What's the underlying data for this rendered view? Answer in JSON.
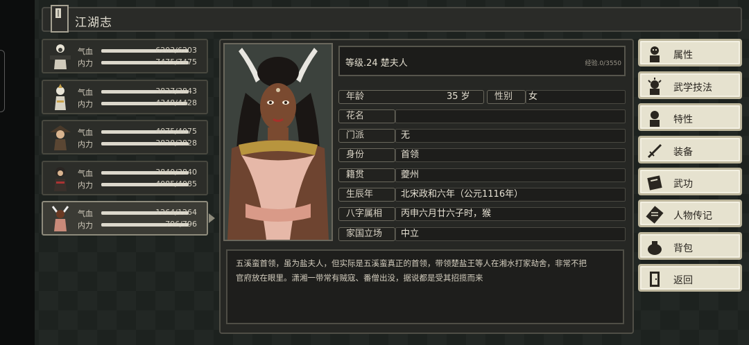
{
  "title": "江湖志",
  "party": [
    {
      "hp_label": "气血",
      "hp_text": "6203/6203",
      "hp": 1.0,
      "mp_label": "内力",
      "mp_text": "7475/7475",
      "mp": 1.0
    },
    {
      "hp_label": "气血",
      "hp_text": "3837/3843",
      "hp": 0.998,
      "mp_label": "内力",
      "mp_text": "4348/4428",
      "mp": 0.982
    },
    {
      "hp_label": "气血",
      "hp_text": "4075/4075",
      "hp": 1.0,
      "mp_label": "内力",
      "mp_text": "3828/3828",
      "mp": 1.0
    },
    {
      "hp_label": "气血",
      "hp_text": "3840/3840",
      "hp": 1.0,
      "mp_label": "内力",
      "mp_text": "4085/4085",
      "mp": 1.0
    },
    {
      "hp_label": "气血",
      "hp_text": "1264/1264",
      "hp": 1.0,
      "mp_label": "内力",
      "mp_text": "796/796",
      "mp": 1.0
    }
  ],
  "character": {
    "level_line": "等级.24 楚夫人",
    "exp": "经验.0/3550",
    "age_label": "年龄",
    "age_value": "35 岁",
    "gender_label": "性别",
    "gender_value": "女",
    "nickname_label": "花名",
    "nickname_value": "",
    "sect_label": "门派",
    "sect_value": "无",
    "identity_label": "身份",
    "identity_value": "首领",
    "origin_label": "籍贯",
    "origin_value": "夔州",
    "birth_label": "生辰年",
    "birth_value": "北宋政和六年（公元1116年）",
    "bazi_label": "八字属相",
    "bazi_value": "丙申六月廿六子时，猴",
    "stance_label": "家国立场",
    "stance_value": "中立",
    "bio_line1": "五溪蛮首领，虽为盐夫人，但实际是五溪蛮真正的首领，带领楚盐王等人在湘水打家劫舍，非常不把",
    "bio_line2": "官府放在眼里。潇湘一带常有贼寇、番僧出没，据说都是受其招揽而来"
  },
  "menu": [
    "属性",
    "武学技法",
    "特性",
    "装备",
    "武功",
    "人物传记",
    "背包",
    "返回"
  ],
  "colors": {
    "panel": "#262724",
    "button": "#e6e2cf",
    "accent": "#8e8b7c"
  }
}
